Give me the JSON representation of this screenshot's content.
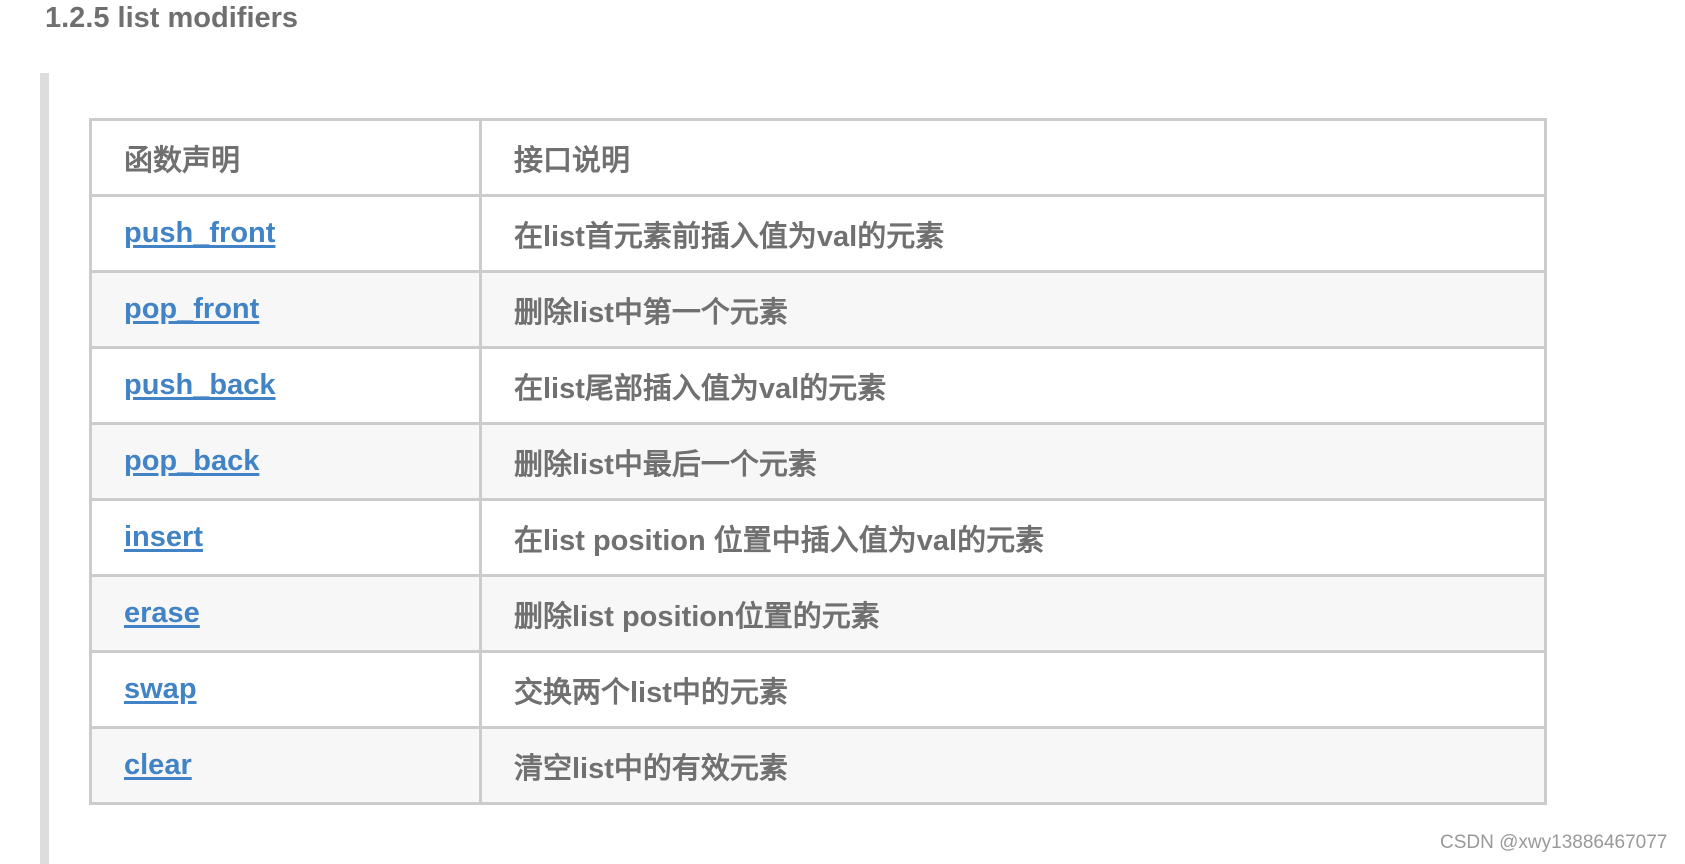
{
  "section": {
    "title": "1.2.5 list modifiers"
  },
  "table": {
    "headers": [
      "函数声明",
      "接口说明"
    ],
    "rows": [
      {
        "function": "push_front",
        "description": "在list首元素前插入值为val的元素"
      },
      {
        "function": "pop_front",
        "description": "删除list中第一个元素"
      },
      {
        "function": "push_back",
        "description": "在list尾部插入值为val的元素"
      },
      {
        "function": "pop_back",
        "description": "删除list中最后一个元素"
      },
      {
        "function": "insert",
        "description": "在list position 位置中插入值为val的元素"
      },
      {
        "function": "erase",
        "description": "删除list position位置的元素"
      },
      {
        "function": "swap",
        "description": "交换两个list中的元素"
      },
      {
        "function": "clear",
        "description": "清空list中的有效元素"
      }
    ]
  },
  "colors": {
    "link": "#4183c4",
    "text": "#707070",
    "border": "#cccccc",
    "stripe": "#f7f7f7",
    "quote_bar": "#dddddd"
  },
  "watermark": "CSDN @xwy13886467077"
}
